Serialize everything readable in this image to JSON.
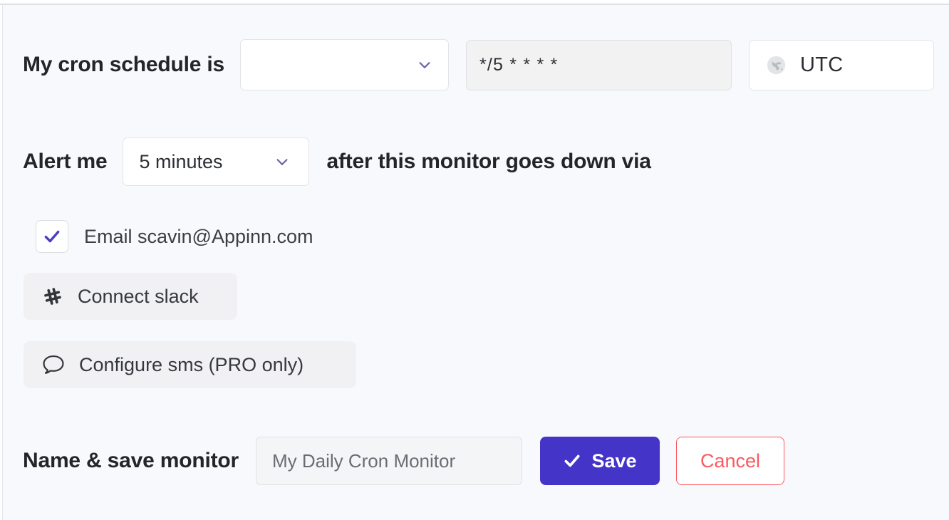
{
  "schedule_row": {
    "label": "My cron schedule is",
    "preset_select": {
      "value": "",
      "placeholder": "",
      "chevron_icon": "chevron-down-icon",
      "chevron_color": "#6f62a6"
    },
    "cron_expression": {
      "value": "*/5 * * * *",
      "placeholder": "*/5 * * * *"
    },
    "timezone": {
      "icon": "globe-icon",
      "value": "UTC"
    }
  },
  "alert_row": {
    "label_before": "Alert me",
    "delay_select": {
      "value": "5 minutes",
      "chevron_icon": "chevron-down-icon"
    },
    "label_after": "after this monitor goes down via"
  },
  "channels": {
    "email": {
      "checkbox_icon": "check-icon",
      "checked": true,
      "label": "Email scavin@Appinn.com",
      "check_color": "#4a3fc4"
    },
    "slack": {
      "icon": "slack-hash-icon",
      "label": "Connect slack"
    },
    "sms": {
      "icon": "speech-bubble-icon",
      "label": "Configure sms (PRO only)"
    }
  },
  "save_row": {
    "label": "Name & save monitor",
    "name_input": {
      "value": "My Daily Cron Monitor",
      "placeholder": "My Daily Cron Monitor"
    },
    "save_button": {
      "label": "Save",
      "icon": "check-icon",
      "background_color": "#4434c7",
      "text_color": "#ffffff"
    },
    "cancel_button": {
      "label": "Cancel",
      "border_color": "#fa5a5f",
      "text_color": "#fa5a5f"
    }
  },
  "theme": {
    "page_background": "#f8f9fc",
    "accent_color": "#4434c7",
    "danger_color": "#fa5a5f",
    "field_fill": "#f2f2f3"
  }
}
